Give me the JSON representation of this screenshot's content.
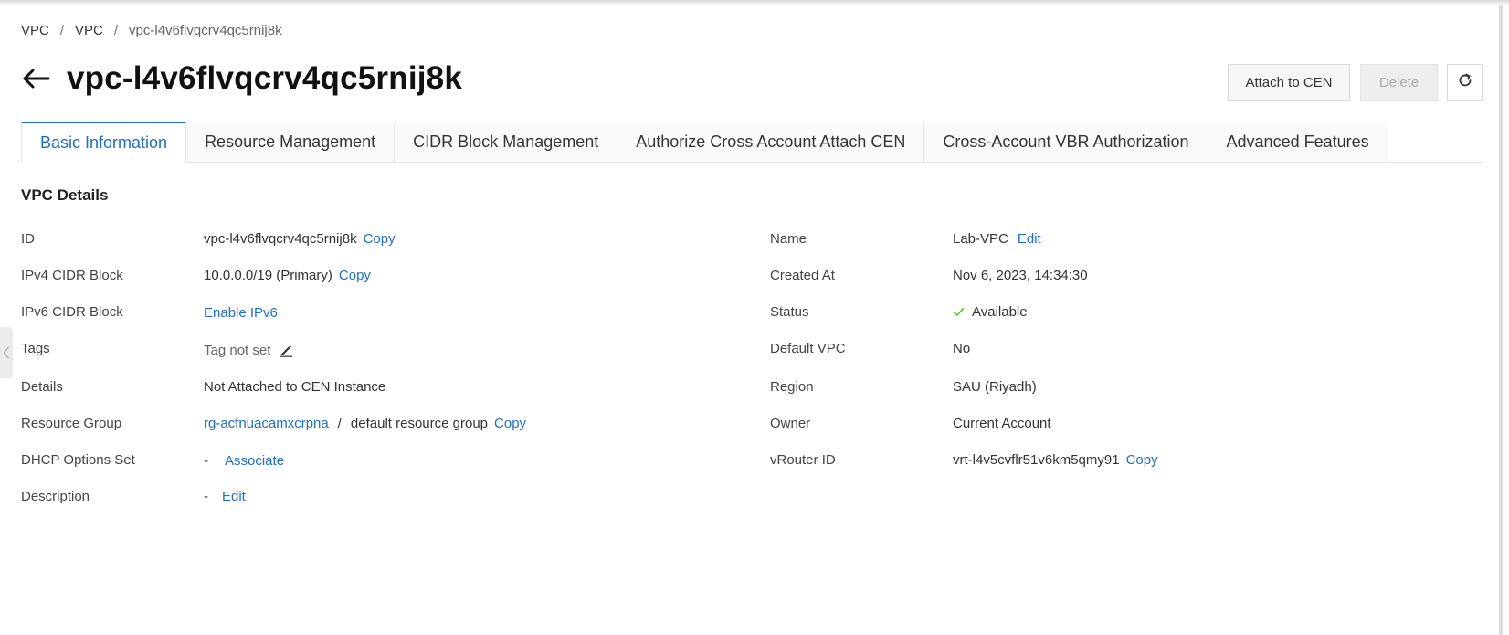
{
  "breadcrumb": [
    "VPC",
    "VPC",
    "vpc-l4v6flvqcrv4qc5rnij8k"
  ],
  "breadcrumb_sep": "/",
  "title": "vpc-l4v6flvqcrv4qc5rnij8k",
  "buttons": {
    "attach": "Attach to CEN",
    "delete": "Delete"
  },
  "tabs": [
    {
      "label": "Basic Information",
      "active": true
    },
    {
      "label": "Resource Management"
    },
    {
      "label": "CIDR Block Management"
    },
    {
      "label": "Authorize Cross Account Attach CEN"
    },
    {
      "label": "Cross-Account VBR Authorization"
    },
    {
      "label": "Advanced Features"
    }
  ],
  "section_title": "VPC Details",
  "left": {
    "id": {
      "label": "ID",
      "value": "vpc-l4v6flvqcrv4qc5rnij8k",
      "action": "Copy"
    },
    "ipv4": {
      "label": "IPv4 CIDR Block",
      "value": "10.0.0.0/19 (Primary)",
      "action": "Copy"
    },
    "ipv6": {
      "label": "IPv6 CIDR Block",
      "action": "Enable IPv6"
    },
    "tags": {
      "label": "Tags",
      "value": "Tag not set"
    },
    "details": {
      "label": "Details",
      "value": "Not Attached to CEN Instance"
    },
    "resource_group": {
      "label": "Resource Group",
      "link": "rg-acfnuacamxcrpna",
      "sep": "/",
      "value": "default resource group",
      "action": "Copy"
    },
    "dhcp": {
      "label": "DHCP Options Set",
      "dash": "-",
      "action": "Associate"
    },
    "description": {
      "label": "Description",
      "dash": "-",
      "action": "Edit"
    }
  },
  "right": {
    "name": {
      "label": "Name",
      "value": "Lab-VPC",
      "action": "Edit"
    },
    "created": {
      "label": "Created At",
      "value": "Nov 6, 2023, 14:34:30"
    },
    "status": {
      "label": "Status",
      "value": "Available"
    },
    "default_vpc": {
      "label": "Default VPC",
      "value": "No"
    },
    "region": {
      "label": "Region",
      "value": "SAU (Riyadh)"
    },
    "owner": {
      "label": "Owner",
      "value": "Current Account"
    },
    "vrouter": {
      "label": "vRouter ID",
      "value": "vrt-l4v5cvflr51v6km5qmy91",
      "action": "Copy"
    }
  },
  "colors": {
    "link": "#1f6fc5",
    "status_ok": "#52c41a"
  },
  "icons": {
    "back": "arrow-left-icon",
    "refresh": "refresh-icon",
    "tag_edit": "pencil-icon",
    "status": "check-icon",
    "collapse": "chevron-left-icon"
  }
}
